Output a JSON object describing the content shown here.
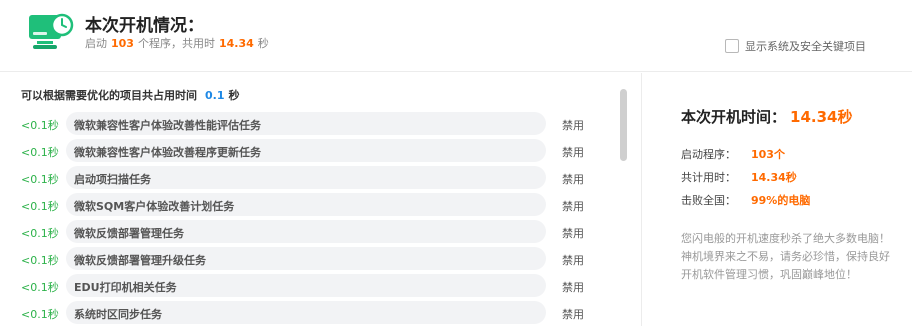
{
  "header": {
    "title": "本次开机情况：",
    "subtitle_prefix": "启动",
    "program_count": "103",
    "subtitle_middle": "个程序，共用时",
    "total_time": "14.34",
    "subtitle_suffix": "秒",
    "show_system_items_label": "显示系统及安全关键项目"
  },
  "optimizable": {
    "label": "可以根据需要优化的项目共占用时间",
    "time": "0.1",
    "unit": "秒",
    "items": [
      {
        "time": "<0.1秒",
        "name": "微软兼容性客户体验改善性能评估任务",
        "action": "禁用"
      },
      {
        "time": "<0.1秒",
        "name": "微软兼容性客户体验改善程序更新任务",
        "action": "禁用"
      },
      {
        "time": "<0.1秒",
        "name": "启动项扫描任务",
        "action": "禁用"
      },
      {
        "time": "<0.1秒",
        "name": "微软SQM客户体验改善计划任务",
        "action": "禁用"
      },
      {
        "time": "<0.1秒",
        "name": "微软反馈部署管理任务",
        "action": "禁用"
      },
      {
        "time": "<0.1秒",
        "name": "微软反馈部署管理升级任务",
        "action": "禁用"
      },
      {
        "time": "<0.1秒",
        "name": "EDU打印机相关任务",
        "action": "禁用"
      },
      {
        "time": "<0.1秒",
        "name": "系统时区同步任务",
        "action": "禁用"
      }
    ]
  },
  "summary": {
    "boot_time_label": "本次开机时间：",
    "boot_time_value": "14.34秒",
    "stats": [
      {
        "label": "启动程序：",
        "value": "103个"
      },
      {
        "label": "共计用时：",
        "value": "14.34秒"
      },
      {
        "label": "击败全国：",
        "value": "99%的电脑"
      }
    ],
    "description": "您闪电般的开机速度秒杀了绝大多数电脑！神机境界来之不易，请务必珍惜，保持良好开机软件管理习惯，巩固巅峰地位！"
  },
  "colors": {
    "accent_orange": "#ff6a00",
    "accent_green": "#2db24a",
    "accent_blue": "#1e88e5",
    "icon_green": "#1fbf7a"
  },
  "icons": {
    "app": "monitor-clock-icon"
  }
}
